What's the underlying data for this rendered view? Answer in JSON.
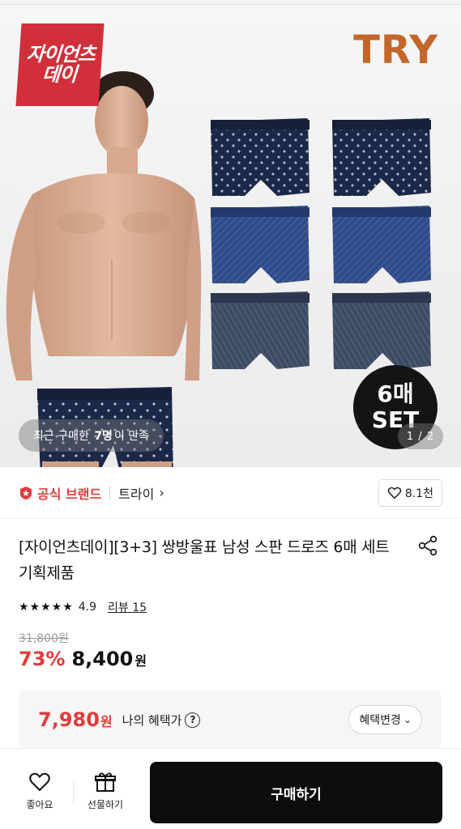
{
  "hero": {
    "sale_badge_line1": "자이언츠",
    "sale_badge_line2": "데이",
    "brand_logo": "TRY",
    "set_badge_line1": "6매",
    "set_badge_line2": "SET",
    "recent_prefix": "최근 구매한",
    "recent_count": "7명",
    "recent_suffix": "이 만족",
    "pager": "1 / 2",
    "underwear_colors": [
      "#1c2847",
      "#2f4a86",
      "#3c4a63"
    ]
  },
  "brand_row": {
    "official_label": "공식 브랜드",
    "brand_name": "트라이",
    "brand_chevron": "›",
    "like_count": "8.1천"
  },
  "product": {
    "title": "[자이언츠데이][3+3] 쌍방울표 남성 스판 드로즈 6매 세트 기획제품",
    "stars": "★★★★★",
    "rating": "4.9",
    "review_label": "리뷰 15",
    "original_price": "31,800원",
    "discount": "73%",
    "price": "8,400",
    "price_unit": "원"
  },
  "benefit": {
    "price": "7,980",
    "price_unit": "원",
    "label": "나의 혜택가",
    "help": "?",
    "change_label": "혜택변경",
    "change_chevron": "⌄"
  },
  "bottom_bar": {
    "like_label": "좋아요",
    "gift_label": "선물하기",
    "buy_label": "구매하기"
  },
  "colors": {
    "accent_red": "#e23b3b",
    "badge_red": "#d1303a",
    "brand_orange": "#c4662a",
    "buy_black": "#0d0d0d"
  }
}
